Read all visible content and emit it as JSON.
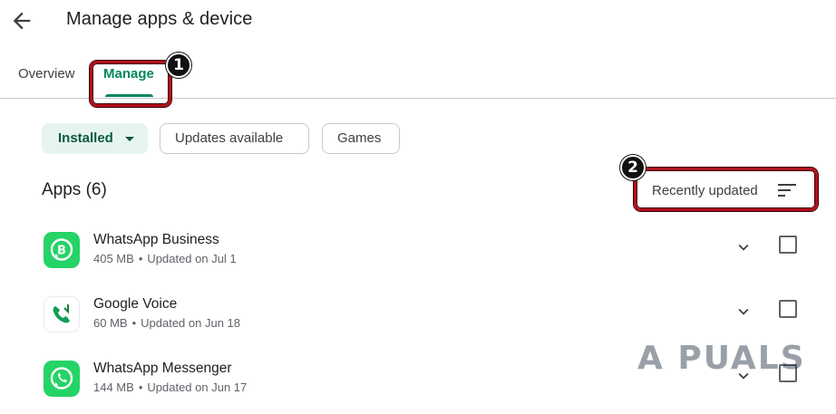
{
  "header": {
    "title": "Manage apps & device",
    "back_icon": "arrow-left-icon"
  },
  "tabs": [
    {
      "label": "Overview",
      "selected": false
    },
    {
      "label": "Manage",
      "selected": true
    }
  ],
  "annotations": {
    "step1": "1",
    "step2": "2",
    "highlight_color": "#b00f1a"
  },
  "filters": {
    "installed": "Installed",
    "updates": "Updates available",
    "games": "Games"
  },
  "apps_section": {
    "heading": "Apps (6)",
    "sort_label": "Recently updated",
    "sort_icon": "sort-lines-icon"
  },
  "apps": [
    {
      "name": "WhatsApp Business",
      "size": "405 MB",
      "updated": "Updated on Jul 1",
      "icon": "whatsapp-business-icon"
    },
    {
      "name": "Google Voice",
      "size": "60 MB",
      "updated": "Updated on Jun 18",
      "icon": "google-voice-icon"
    },
    {
      "name": "WhatsApp Messenger",
      "size": "144 MB",
      "updated": "Updated on Jun 17",
      "icon": "whatsapp-icon"
    }
  ],
  "separator": "•",
  "watermark": "A PUALS",
  "colors": {
    "accent": "#01875f",
    "chip_selected_bg": "#e6f4ef",
    "whatsapp_green": "#25d366",
    "annotation_red": "#b00f1a"
  }
}
